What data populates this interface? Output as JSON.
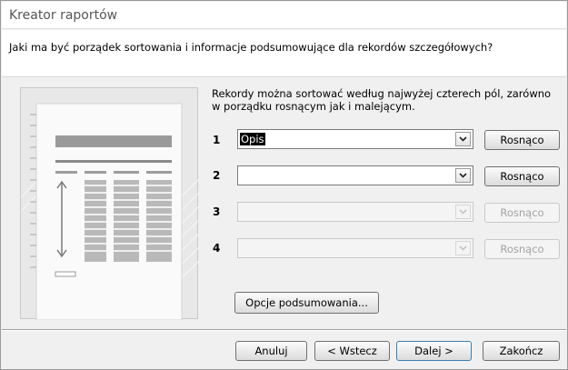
{
  "window": {
    "title": "Kreator raportów"
  },
  "header": {
    "question": "Jaki ma być porządek sortowania i informacje podsumowujące dla rekordów szczegółowych?"
  },
  "intro": "Rekordy można sortować według najwyżej czterech pól, zarówno w porządku rosnącym jak i malejącym.",
  "sort_rows": [
    {
      "number": "1",
      "field": "Opis",
      "order": "Rosnąco",
      "enabled": true
    },
    {
      "number": "2",
      "field": "",
      "order": "Rosnąco",
      "enabled": true
    },
    {
      "number": "3",
      "field": "",
      "order": "Rosnąco",
      "enabled": false
    },
    {
      "number": "4",
      "field": "",
      "order": "Rosnąco",
      "enabled": false
    }
  ],
  "summary_button": {
    "label": "Opcje podsumowania..."
  },
  "footer": {
    "cancel": "Anuluj",
    "back": "< Wstecz",
    "next": "Dalej >",
    "finish": "Zakończ"
  },
  "icons": {
    "dropdown": "chevron-down-icon",
    "preview": "report-preview-illustration"
  }
}
